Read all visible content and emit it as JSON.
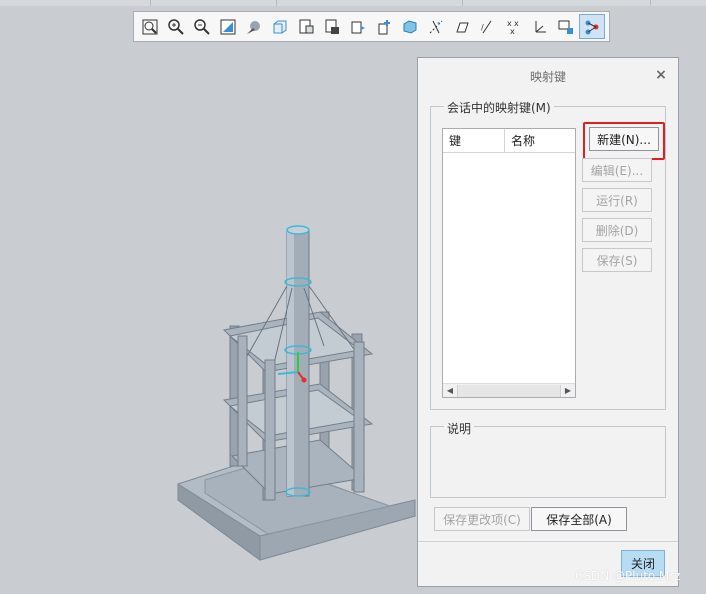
{
  "toolbar": {
    "icons": [
      "zoom-fit-icon",
      "zoom-in-icon",
      "zoom-out-icon",
      "repaint-icon",
      "display-style-icon",
      "saved-orientations-icon",
      "view-manager-icon",
      "appearance-icon",
      "spin-center-icon",
      "plane-display-icon",
      "axis-display-icon",
      "point-display-icon",
      "csys-display-icon",
      "annotation-display-icon",
      "layer-tree-icon",
      "mapkey-icon"
    ]
  },
  "dialog": {
    "title": "映射键",
    "close_glyph": "×",
    "session_group_label": "会话中的映射键(M)",
    "columns": {
      "key": "键",
      "name": "名称"
    },
    "buttons": {
      "new": "新建(N)...",
      "edit": "编辑(E)...",
      "run": "运行(R)",
      "delete": "删除(D)",
      "save": "保存(S)"
    },
    "description_group_label": "说明",
    "save_changes": "保存更改项(C)",
    "save_all": "保存全部(A)",
    "close": "关闭"
  },
  "watermark": "CSDN @Pluto.Mrz",
  "colors": {
    "background": "#c9cdd1",
    "model_fill": "#a9b3bd",
    "highlight_border": "#e02020",
    "close_button": "#b7dcf3",
    "active_tool": "#cfe3f5"
  }
}
